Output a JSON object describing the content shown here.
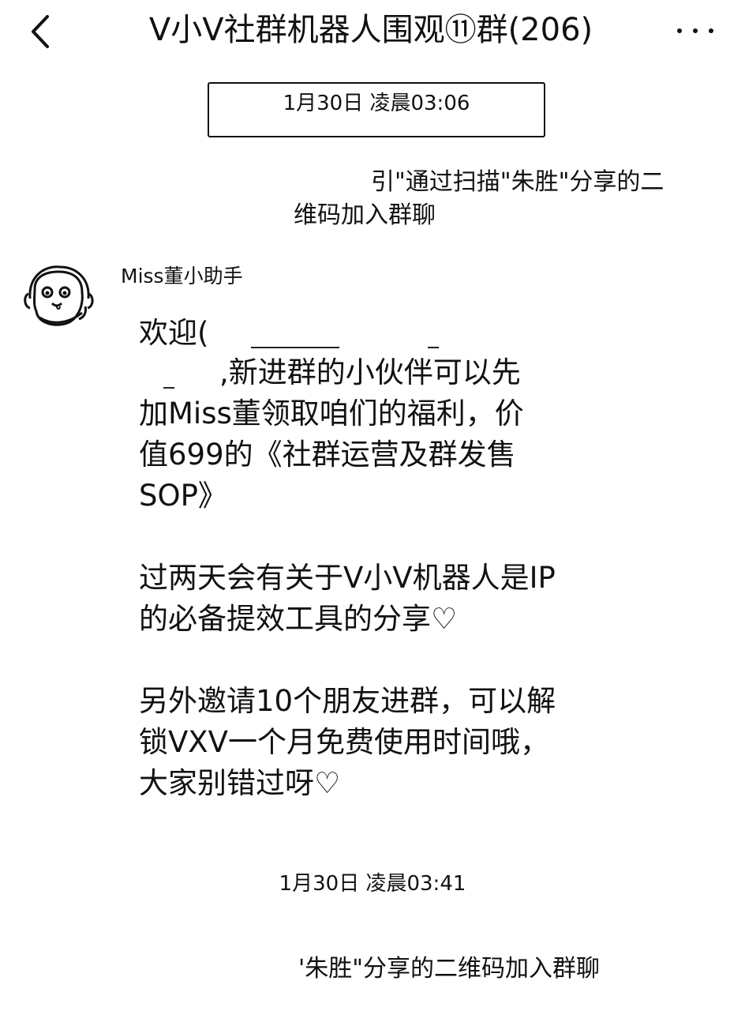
{
  "header": {
    "back_icon": "chevron-left-icon",
    "title": "V小V社群机器人围观⑪群(206)",
    "more_icon": "more-dots-icon"
  },
  "chat": {
    "timestamp_1": "1月30日 凌晨03:06",
    "system_msg_1_line1": "引\"通过扫描\"朱胜\"分享的二",
    "system_msg_1_line2": "维码加入群聊",
    "message": {
      "sender": "Miss董小助手",
      "avatar_icon": "cartoon-avatar-icon",
      "lines": [
        "欢迎(",
        ",新进群的小伙伴可以先",
        "加Miss董领取咱们的福利，价",
        "值699的《社群运营及群发售",
        "SOP》",
        "过两天会有关于V小V机器人是IP",
        "的必备提效工具的分享♡",
        "另外邀请10个朋友进群，可以解",
        "锁VXV一个月免费使用时间哦，",
        "大家别错过呀♡"
      ]
    },
    "timestamp_2": "1月30日 凌晨03:41",
    "system_msg_2": "'朱胜\"分享的二维码加入群聊"
  }
}
